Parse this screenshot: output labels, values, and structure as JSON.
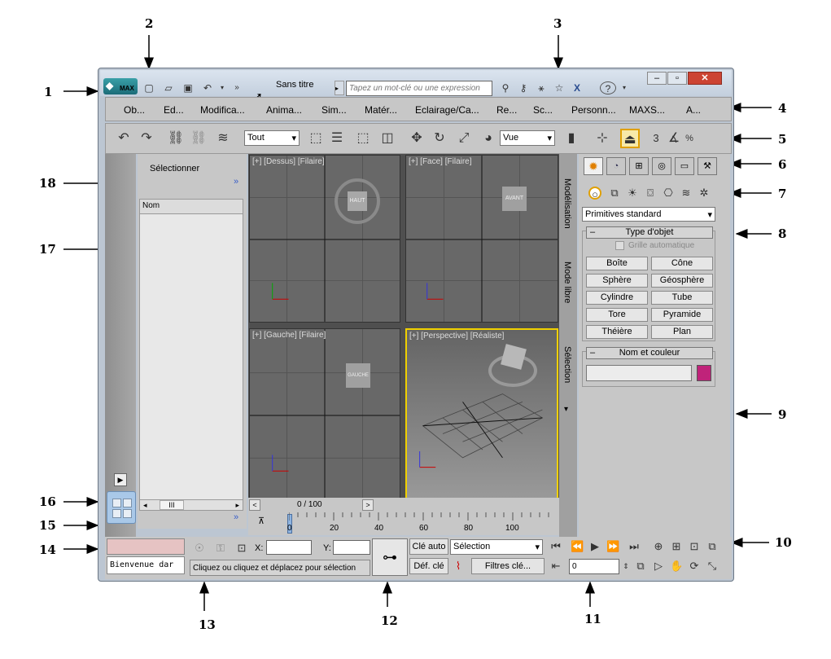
{
  "callouts": [
    "1",
    "2",
    "3",
    "4",
    "5",
    "6",
    "7",
    "8",
    "9",
    "10",
    "11",
    "12",
    "13",
    "14",
    "15",
    "16",
    "17",
    "18"
  ],
  "title": {
    "app_badge": "MAX",
    "doc_title": "Sans titre",
    "search_placeholder": "Tapez un mot-clé ou une expression"
  },
  "menu": [
    "Ob...",
    "Ed...",
    "Modifica...",
    "Anima...",
    "Sim...",
    "Matér...",
    "Eclairage/Ca...",
    "Re...",
    "Sc...",
    "Personn...",
    "MAXS...",
    "A..."
  ],
  "toolbar": {
    "filter": "Tout",
    "view": "Vue",
    "snap_label": "3",
    "percent": "%"
  },
  "scene": {
    "title": "Sélectionner",
    "column": "Nom",
    "more": "»",
    "scroll_label": "III"
  },
  "viewports": {
    "top": "[+] [Dessus] [Filaire]",
    "front": "[+] [Face] [Filaire]",
    "left": "[+] [Gauche] [Filaire]",
    "persp": "[+] [Perspective] [Réaliste]",
    "cube_top": "HAUT",
    "cube_front": "AVANT",
    "cube_left": "GAUCHE"
  },
  "side_tabs": [
    "Modélisation",
    "Mode libre",
    "Sélection"
  ],
  "cmd": {
    "dropdown": "Primitives standard",
    "rollout_type": "Type d'objet",
    "autogrid": "Grille automatique",
    "buttons": [
      "Boîte",
      "Cône",
      "Sphère",
      "Géosphère",
      "Cylindre",
      "Tube",
      "Tore",
      "Pyramide",
      "Théière",
      "Plan"
    ],
    "rollout_name": "Nom et couleur",
    "color": "#c0237a"
  },
  "timeline": {
    "frame": "0 / 100",
    "ticks": [
      "0",
      "20",
      "40",
      "60",
      "80",
      "100"
    ]
  },
  "status": {
    "welcome": "Bienvenue dar",
    "prompt": "Cliquez ou cliquez et déplacez pour sélection",
    "x_label": "X:",
    "y_label": "Y:",
    "auto_key": "Clé auto",
    "set_key": "Déf. clé",
    "selection": "Sélection",
    "key_filters": "Filtres clé...",
    "frame_value": "0"
  }
}
